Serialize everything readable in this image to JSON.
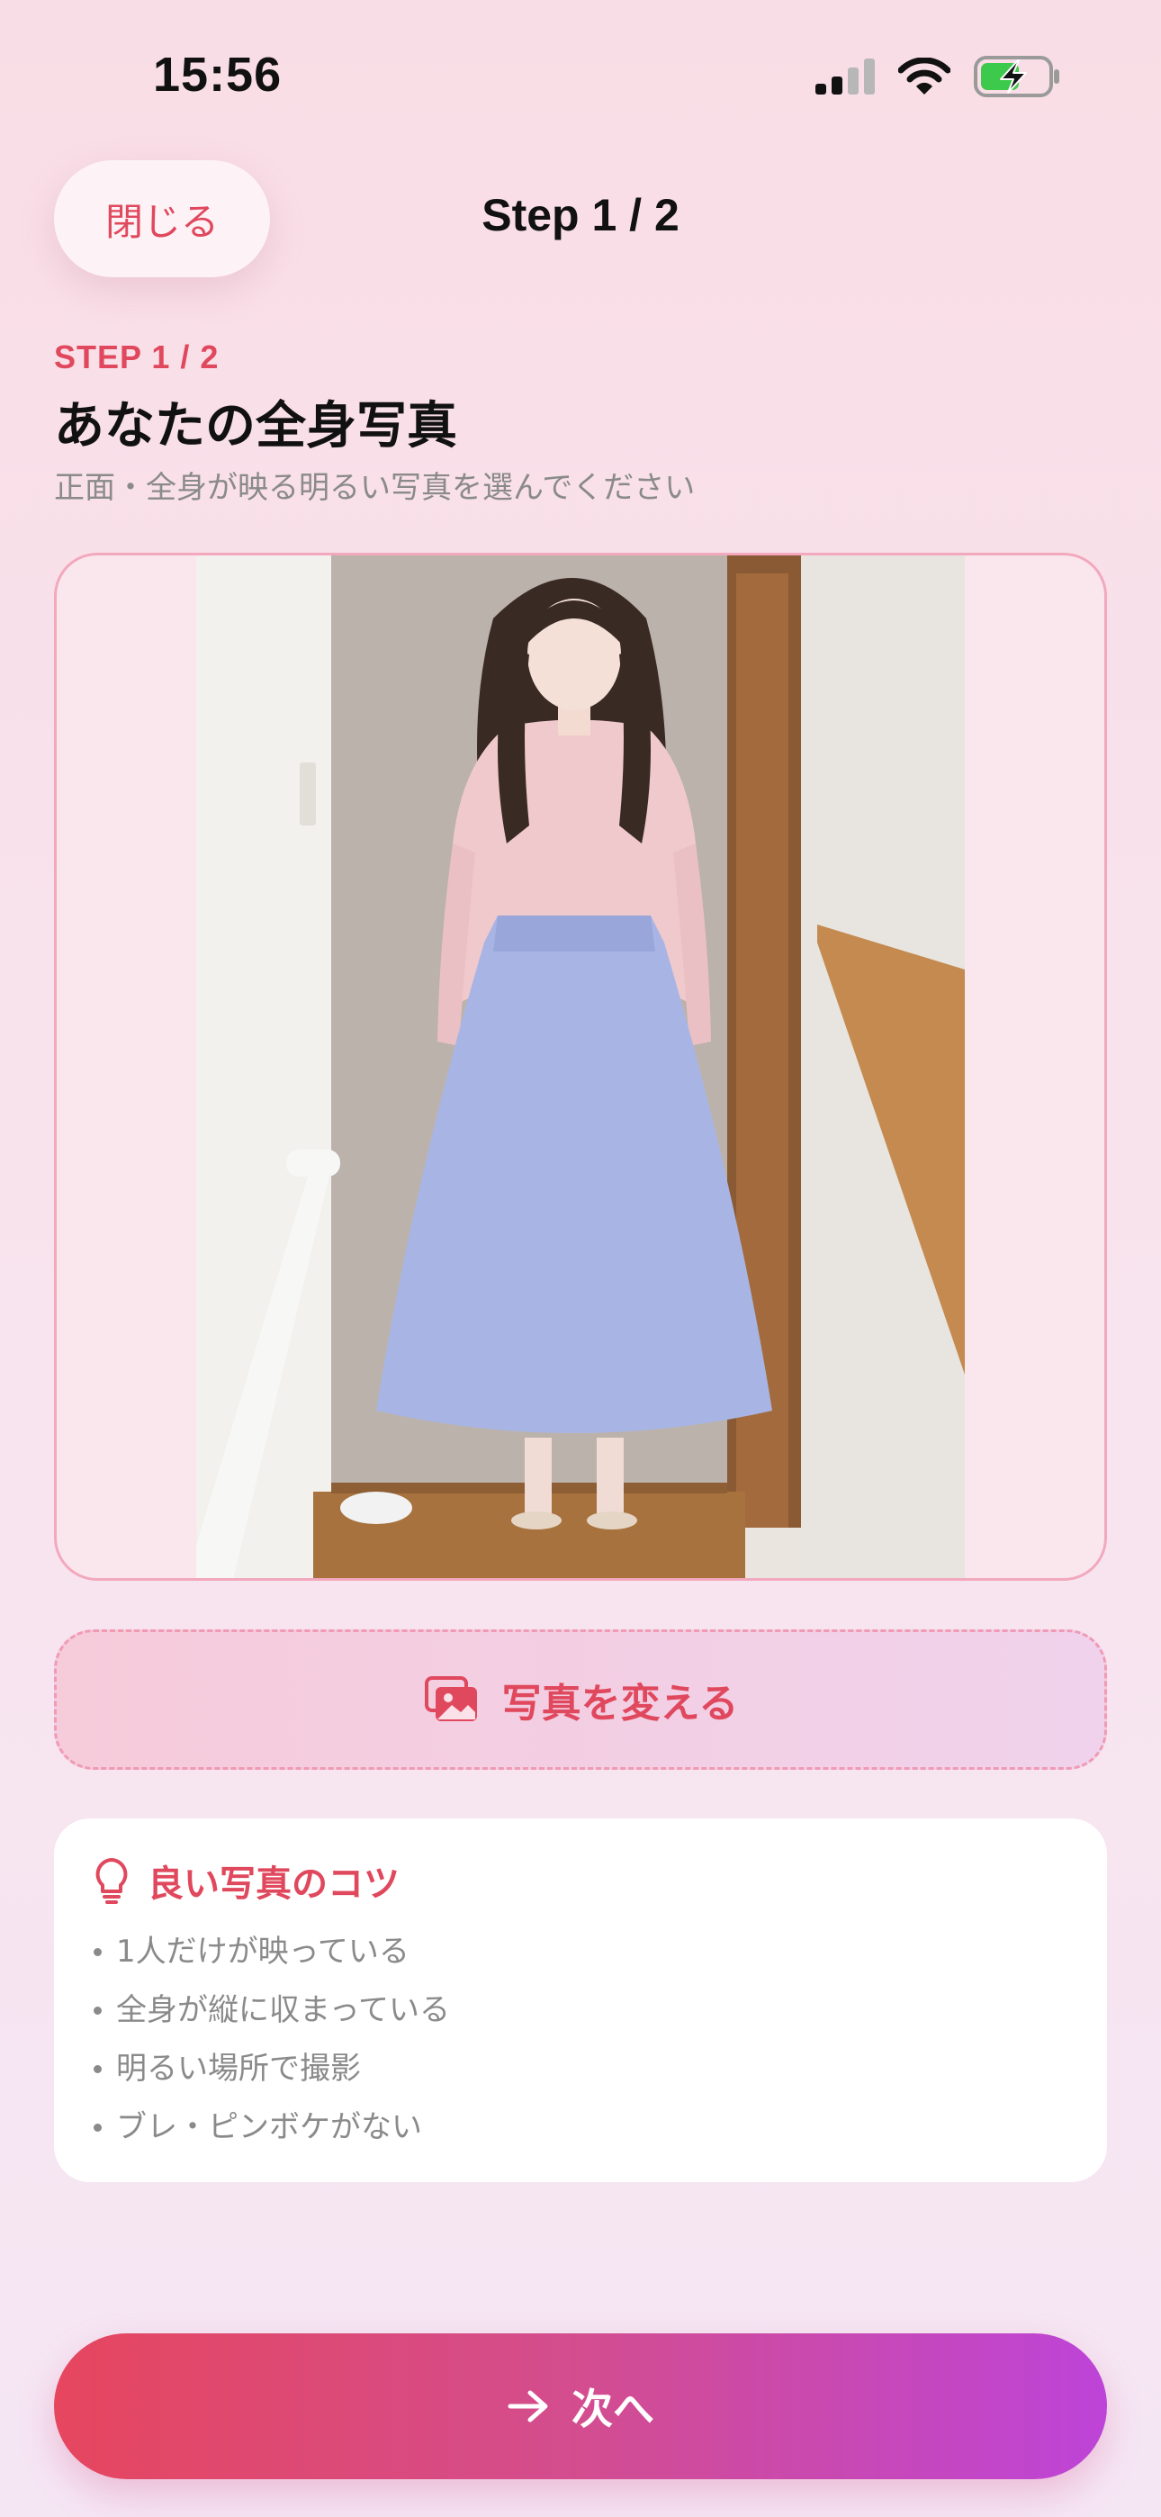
{
  "status": {
    "time": "15:56"
  },
  "header": {
    "close_label": "閉じる",
    "title": "Step 1 / 2"
  },
  "intro": {
    "step_label": "STEP 1 / 2",
    "title": "あなたの全身写真",
    "subtitle": "正面・全身が映る明るい写真を選んでください"
  },
  "actions": {
    "change_photo_label": "写真を変える",
    "next_label": "次へ"
  },
  "tips": {
    "title": "良い写真のコツ",
    "items": [
      "1人だけが映っている",
      "全身が縦に収まっている",
      "明るい場所で撮影",
      "ブレ・ピンボケがない"
    ]
  },
  "colors": {
    "accent": "#e0485d",
    "gradient_start": "#e6465e",
    "gradient_end": "#bd44d8"
  }
}
